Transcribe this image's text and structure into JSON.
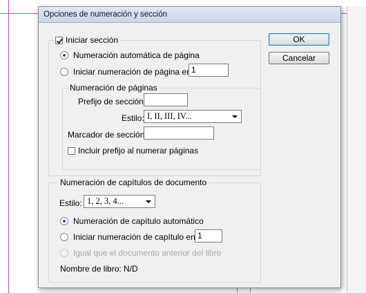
{
  "dialog": {
    "title": "Opciones de numeración y sección",
    "ok_label": "OK",
    "cancel_label": "Cancelar"
  },
  "section": {
    "start_section_label": "Iniciar sección",
    "start_section_checked": true,
    "auto_numbering_label": "Numeración automática de página",
    "auto_numbering_selected": true,
    "start_at_label": "Iniciar numeración de página en:",
    "start_at_value": "1"
  },
  "page_numbering": {
    "legend": "Numeración de páginas",
    "prefix_label": "Prefijo de sección:",
    "prefix_value": "",
    "style_label": "Estilo:",
    "style_value": "I, II, III, IV...",
    "marker_label": "Marcador de sección:",
    "marker_value": "",
    "include_prefix_label": "Incluir prefijo al numerar páginas",
    "include_prefix_checked": false
  },
  "chapter_numbering": {
    "legend": "Numeración de capítulos de documento",
    "style_label": "Estilo:",
    "style_value": "1, 2, 3, 4...",
    "auto_chapter_label": "Numeración de capítulo automático",
    "auto_chapter_selected": true,
    "start_chapter_label": "Iniciar numeración de capítulo en:",
    "start_chapter_value": "1",
    "same_as_previous_label": "Igual que el documento anterior del libro",
    "book_name_label": "Nombre de libro: N/D"
  }
}
